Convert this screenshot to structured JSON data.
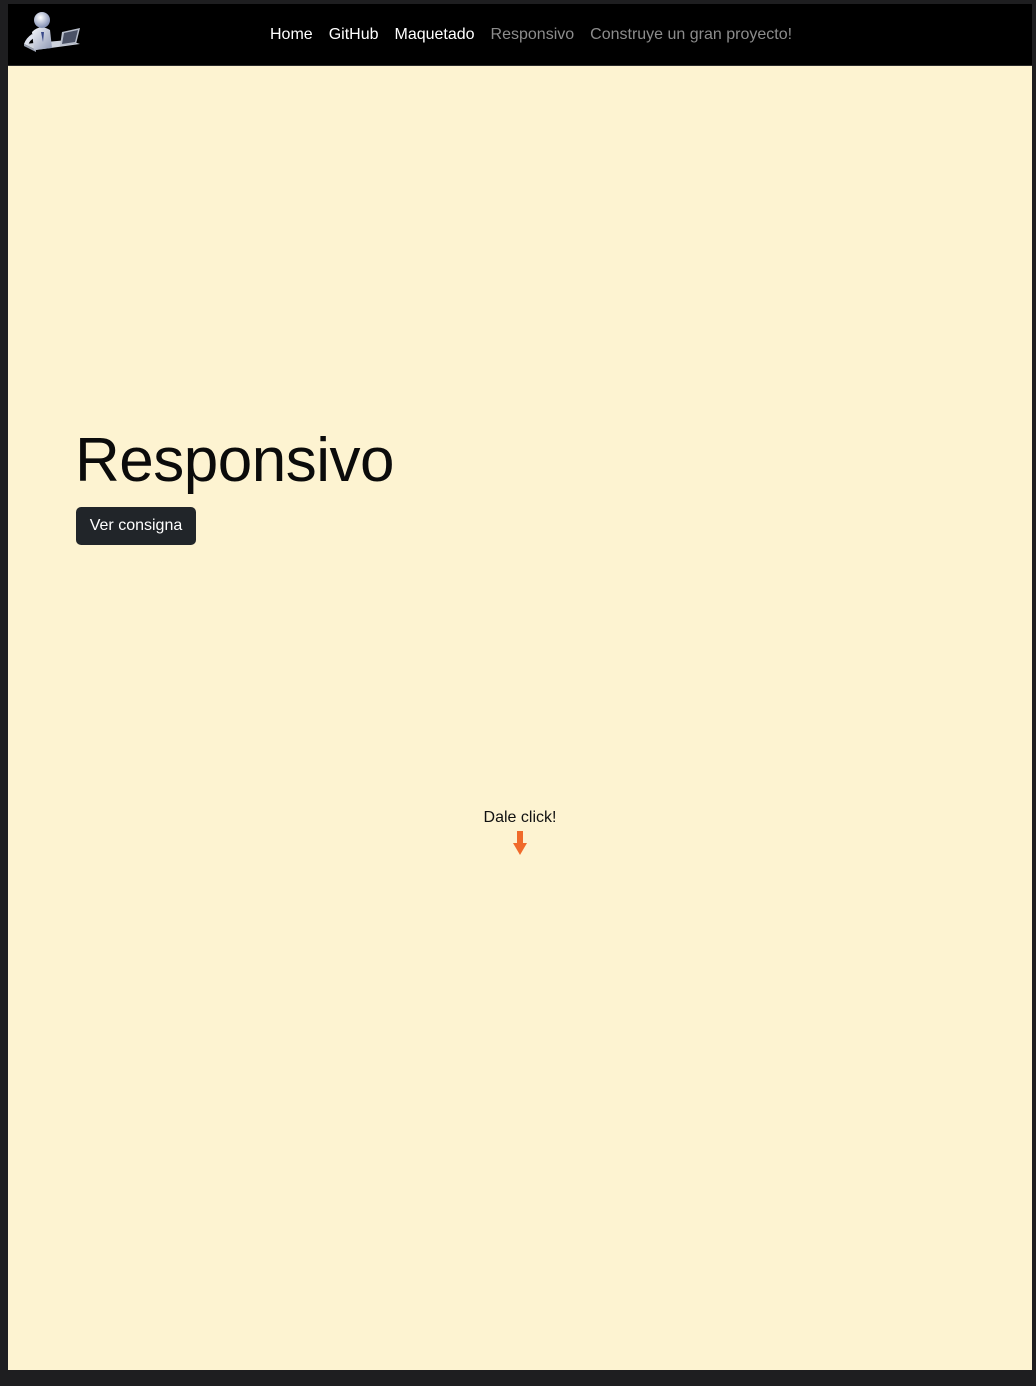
{
  "navbar": {
    "logo_name": "developer-logo-icon",
    "links": [
      {
        "label": "Home",
        "state": "active"
      },
      {
        "label": "GitHub",
        "state": "active"
      },
      {
        "label": "Maquetado",
        "state": "active"
      },
      {
        "label": "Responsivo",
        "state": "muted"
      },
      {
        "label": "Construye un gran proyecto!",
        "state": "muted"
      }
    ]
  },
  "hero": {
    "title": "Responsivo",
    "button_label": "Ver consigna"
  },
  "hint": {
    "text": "Dale click!",
    "icon": "arrow-down-icon"
  },
  "colors": {
    "page_background": "#fdf3d1",
    "navbar_background": "#000000",
    "button_background": "#212529",
    "arrow": "#f06a2a"
  }
}
